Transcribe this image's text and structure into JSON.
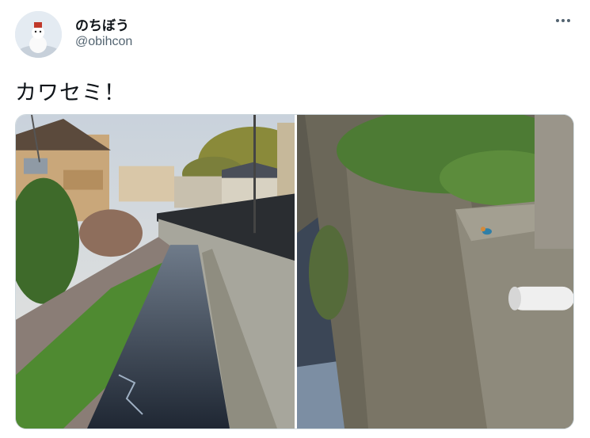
{
  "user": {
    "display_name": "のちぼう",
    "handle": "@obihcon",
    "avatar_icon": "snowman-avatar-icon"
  },
  "tweet": {
    "text": "カワセミ！"
  },
  "menu": {
    "icon": "more-horizontal-icon"
  },
  "media": {
    "count": 2,
    "items": [
      {
        "subject": "canal-photo"
      },
      {
        "subject": "kingfisher-wall-photo"
      }
    ]
  },
  "colors": {
    "text_primary": "#0f1419",
    "text_secondary": "#536471",
    "border": "#cfd9de"
  }
}
